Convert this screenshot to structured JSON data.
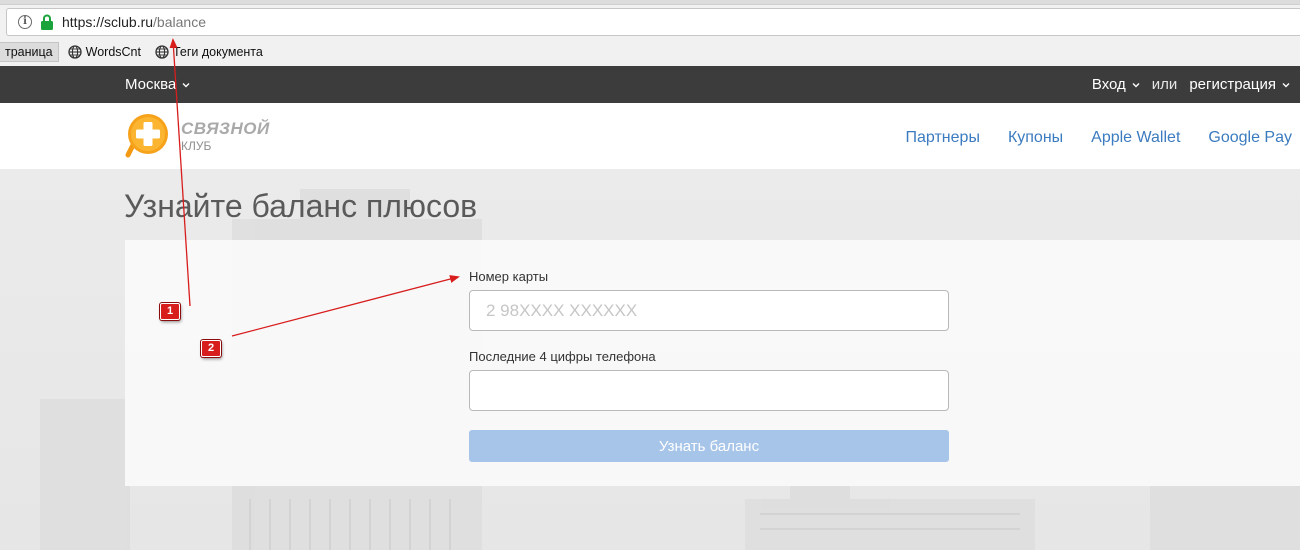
{
  "browser": {
    "url_host": "https://sclub.ru",
    "url_path": "/balance",
    "bookmarks": [
      {
        "label": "траница"
      },
      {
        "label": "WordsCnt"
      },
      {
        "label": "Теги документа"
      }
    ]
  },
  "topbar": {
    "city": "Москва",
    "login": "Вход",
    "or": "или",
    "register": "регистрация"
  },
  "header": {
    "logo": {
      "brand": "СВЯЗНОЙ",
      "sub": "КЛУБ"
    },
    "nav": [
      {
        "label": "Партнеры"
      },
      {
        "label": "Купоны"
      },
      {
        "label": "Apple Wallet"
      },
      {
        "label": "Google Pay"
      }
    ]
  },
  "page": {
    "title": "Узнайте баланс плюсов"
  },
  "form": {
    "card_label": "Номер карты",
    "card_placeholder": "2 98XXXX XXXXXX",
    "card_value": "",
    "phone_label": "Последние 4 цифры телефона",
    "phone_placeholder": "",
    "phone_value": "",
    "submit_label": "Узнать баланс"
  },
  "annotations": [
    {
      "label": "1"
    },
    {
      "label": "2"
    }
  ],
  "colors": {
    "topbar_bg": "#3c3c3c",
    "nav_link": "#3b7bbf",
    "button_bg": "#a7c5e9",
    "logo_orange": "#f7a21b",
    "marker_red": "#d81d1d"
  }
}
